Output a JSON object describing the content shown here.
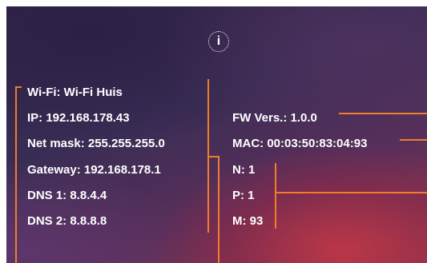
{
  "network": {
    "wifi": "Wi-Fi: Wi-Fi Huis",
    "ip": "IP: 192.168.178.43",
    "net_mask": "Net mask: 255.255.255.0",
    "gateway": "Gateway: 192.168.178.1",
    "dns1": "DNS 1: 8.8.4.4",
    "dns2": "DNS 2: 8.8.8.8"
  },
  "device": {
    "fw_version": "FW Vers.: 1.0.0",
    "mac": "MAC: 00:03:50:83:04:93",
    "n": "N: 1",
    "p": "P: 1",
    "m": "M: 93"
  },
  "icons": {
    "info": "info-icon",
    "info_glyph": "i"
  },
  "colors": {
    "accent_line": "#ef7d2a",
    "text": "#ffffff"
  }
}
